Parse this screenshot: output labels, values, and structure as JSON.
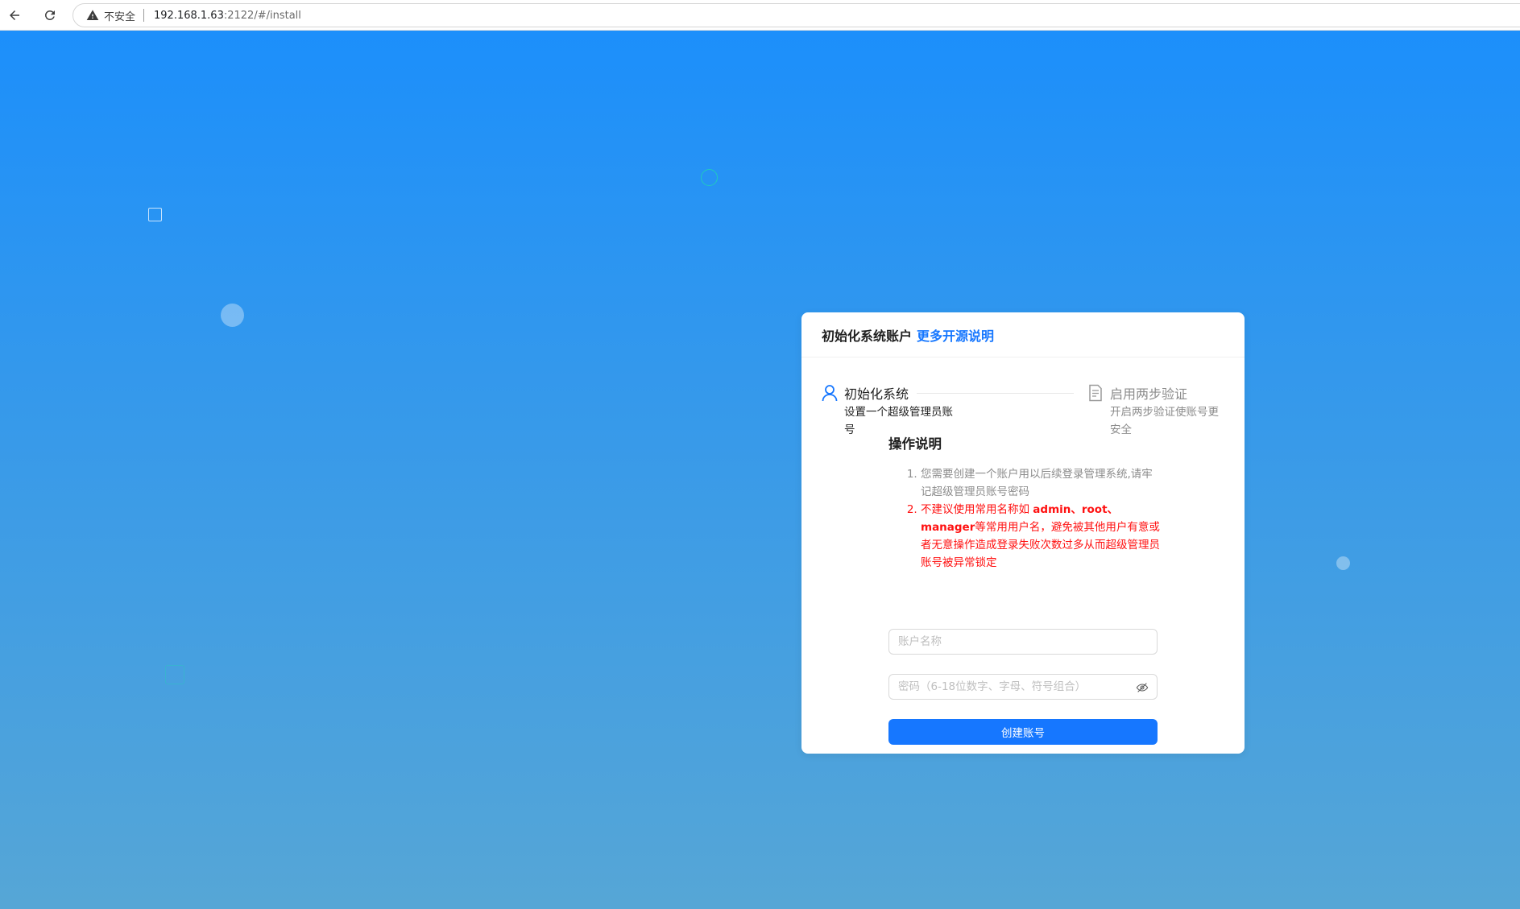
{
  "browser": {
    "insecure_label": "不安全",
    "url_host": "192.168.1.63",
    "url_path": ":2122/#/install"
  },
  "card": {
    "title": "初始化系统账户",
    "link": "更多开源说明"
  },
  "steps": [
    {
      "title": "初始化系统",
      "description": "设置一个超级管理员账号",
      "icon": "user-icon",
      "status": "active"
    },
    {
      "title": "启用两步验证",
      "description": "开启两步验证使账号更安全",
      "icon": "document-icon",
      "status": "waiting"
    }
  ],
  "instructions": {
    "heading": "操作说明",
    "item1": "您需要创建一个账户用以后续登录管理系统,请牢记超级管理员账号密码",
    "item2_prefix": "不建议使用常用名称如 ",
    "item2_bold": "admin、root、manager",
    "item2_suffix": "等常用用户名，避免被其他用户有意或者无意操作造成登录失败次数过多从而超级管理员账号被异常锁定"
  },
  "form": {
    "username_placeholder": "账户名称",
    "password_placeholder": "密码（6-18位数字、字母、符号组合）",
    "submit_label": "创建账号"
  },
  "colors": {
    "primary": "#1677ff",
    "danger": "#ff1111",
    "background_top": "#1c8ffb",
    "background_bottom": "#56a6d6"
  }
}
